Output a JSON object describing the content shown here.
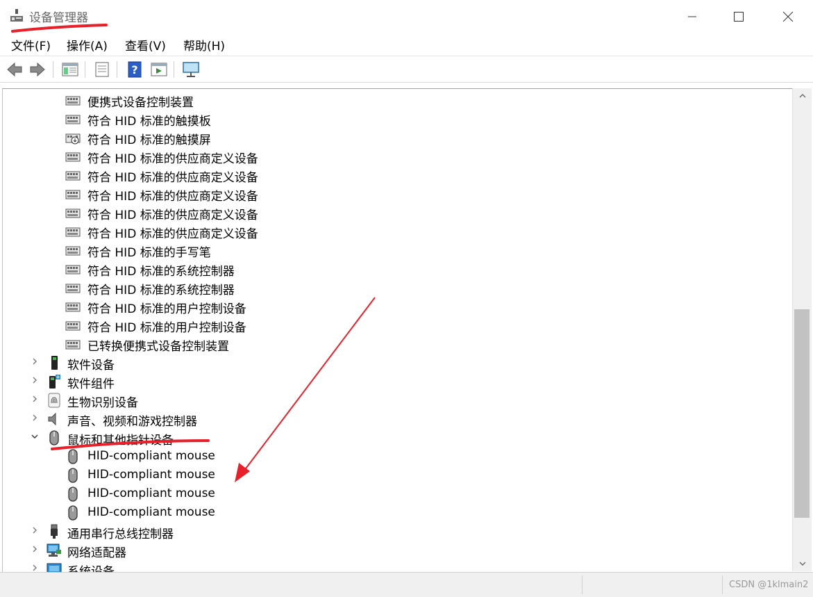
{
  "window": {
    "title": "设备管理器"
  },
  "menu": [
    "文件(F)",
    "操作(A)",
    "查看(V)",
    "帮助(H)"
  ],
  "toolbar": [
    "back-icon",
    "forward-icon",
    "show-hide-tree-icon",
    "properties-icon",
    "help-icon",
    "action-pane-icon",
    "monitor-icon"
  ],
  "tree": [
    {
      "indent": 2,
      "label": "便携式设备控制装置",
      "icon": "hid-device-icon"
    },
    {
      "indent": 2,
      "label": "符合 HID 标准的触摸板",
      "icon": "hid-device-icon"
    },
    {
      "indent": 2,
      "label": "符合 HID 标准的触摸屏",
      "icon": "hid-device-disabled-icon"
    },
    {
      "indent": 2,
      "label": "符合 HID 标准的供应商定义设备",
      "icon": "hid-device-icon"
    },
    {
      "indent": 2,
      "label": "符合 HID 标准的供应商定义设备",
      "icon": "hid-device-icon"
    },
    {
      "indent": 2,
      "label": "符合 HID 标准的供应商定义设备",
      "icon": "hid-device-icon"
    },
    {
      "indent": 2,
      "label": "符合 HID 标准的供应商定义设备",
      "icon": "hid-device-icon"
    },
    {
      "indent": 2,
      "label": "符合 HID 标准的供应商定义设备",
      "icon": "hid-device-icon"
    },
    {
      "indent": 2,
      "label": "符合 HID 标准的手写笔",
      "icon": "hid-device-icon"
    },
    {
      "indent": 2,
      "label": "符合 HID 标准的系统控制器",
      "icon": "hid-device-icon"
    },
    {
      "indent": 2,
      "label": "符合 HID 标准的系统控制器",
      "icon": "hid-device-icon"
    },
    {
      "indent": 2,
      "label": "符合 HID 标准的用户控制设备",
      "icon": "hid-device-icon"
    },
    {
      "indent": 2,
      "label": "符合 HID 标准的用户控制设备",
      "icon": "hid-device-icon"
    },
    {
      "indent": 2,
      "label": "已转换便携式设备控制装置",
      "icon": "hid-device-icon"
    },
    {
      "indent": 1,
      "label": "软件设备",
      "icon": "software-device-icon",
      "expander": "collapsed"
    },
    {
      "indent": 1,
      "label": "软件组件",
      "icon": "software-component-icon",
      "expander": "collapsed"
    },
    {
      "indent": 1,
      "label": "生物识别设备",
      "icon": "fingerprint-icon",
      "expander": "collapsed"
    },
    {
      "indent": 1,
      "label": "声音、视频和游戏控制器",
      "icon": "speaker-icon",
      "expander": "collapsed"
    },
    {
      "indent": 1,
      "label": "鼠标和其他指针设备",
      "icon": "mouse-icon",
      "expander": "expanded"
    },
    {
      "indent": 2,
      "label": "HID-compliant mouse",
      "icon": "mouse-icon"
    },
    {
      "indent": 2,
      "label": "HID-compliant mouse",
      "icon": "mouse-icon"
    },
    {
      "indent": 2,
      "label": "HID-compliant mouse",
      "icon": "mouse-icon"
    },
    {
      "indent": 2,
      "label": "HID-compliant mouse",
      "icon": "mouse-icon"
    },
    {
      "indent": 1,
      "label": "通用串行总线控制器",
      "icon": "usb-icon",
      "expander": "collapsed"
    },
    {
      "indent": 1,
      "label": "网络适配器",
      "icon": "network-adapter-icon",
      "expander": "collapsed"
    },
    {
      "indent": 1,
      "label": "系统设备",
      "icon": "system-device-icon",
      "expander": "collapsed"
    }
  ],
  "watermark": "CSDN @1klmain2",
  "colors": {
    "annotation": "#e8202a",
    "selection": "#cce8ff"
  }
}
